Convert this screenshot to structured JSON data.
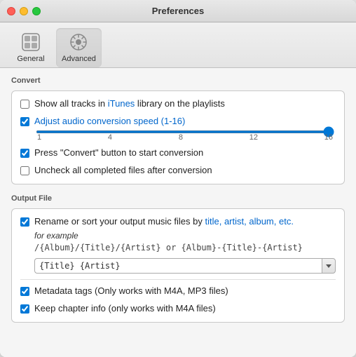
{
  "window": {
    "title": "Preferences"
  },
  "toolbar": {
    "items": [
      {
        "id": "general",
        "label": "General",
        "active": false
      },
      {
        "id": "advanced",
        "label": "Advanced",
        "active": true
      }
    ]
  },
  "convert_section": {
    "title": "Convert",
    "checkboxes": [
      {
        "id": "show-all-tracks",
        "checked": false,
        "label": "Show all tracks in iTunes library on the playlists"
      },
      {
        "id": "adjust-audio-speed",
        "checked": true,
        "label": "Adjust audio conversion speed (1-16)"
      },
      {
        "id": "press-convert",
        "checked": true,
        "label": "Press \"Convert\" button to start conversion"
      },
      {
        "id": "uncheck-completed",
        "checked": false,
        "label": "Uncheck all completed files after conversion"
      }
    ],
    "slider": {
      "min": 1,
      "max": 16,
      "value": 16,
      "labels": [
        "1",
        "4",
        "8",
        "12",
        "16"
      ]
    }
  },
  "output_section": {
    "title": "Output File",
    "rename_label": "Rename or sort your output music files by title, artist, album, etc.",
    "example_label": "for example",
    "example_path": "/{Album}/{Title}/{Artist} or {Album}-{Title}-{Artist}",
    "input_value": "{Title} {Artist}",
    "input_placeholder": "{Title} {Artist}",
    "checkboxes": [
      {
        "id": "metadata-tags",
        "checked": true,
        "label": "Metadata tags (Only works with M4A, MP3 files)"
      },
      {
        "id": "keep-chapter",
        "checked": true,
        "label": "Keep chapter info (only works with  M4A files)"
      }
    ]
  }
}
